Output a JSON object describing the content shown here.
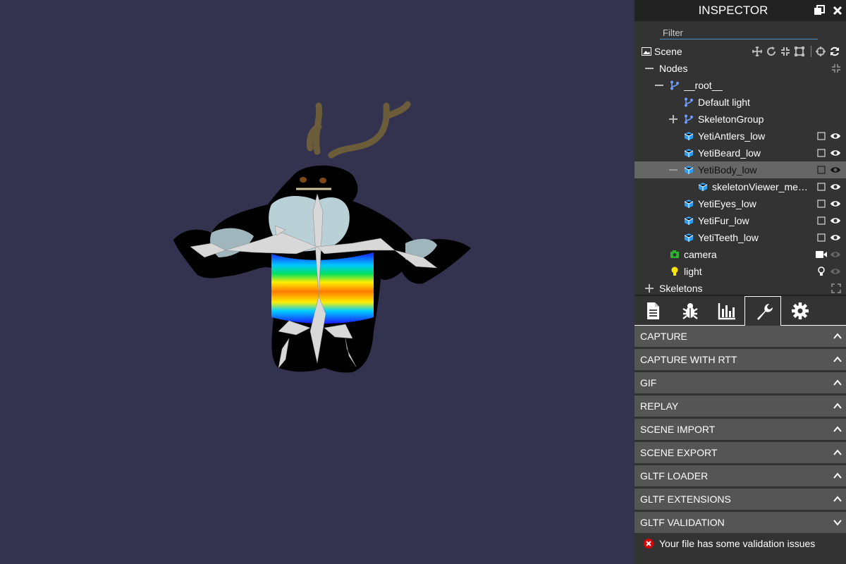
{
  "inspector": {
    "title": "INSPECTOR",
    "filter_placeholder": "Filter"
  },
  "tree": {
    "scene_label": "Scene",
    "nodes_label": "Nodes",
    "root_label": "__root__",
    "default_light": "Default light",
    "skeleton_group": "SkeletonGroup",
    "meshes": [
      "YetiAntlers_low",
      "YetiBeard_low",
      "YetiBody_low",
      "skeletonViewer_me…",
      "YetiEyes_low",
      "YetiFur_low",
      "YetiTeeth_low"
    ],
    "camera_label": "camera",
    "light_label": "light",
    "skeletons_label": "Skeletons"
  },
  "tabs": [
    "properties-tab",
    "debug-tab",
    "statistics-tab",
    "tools-tab",
    "settings-tab"
  ],
  "active_tab": "tools-tab",
  "panes": [
    "CAPTURE",
    "CAPTURE WITH RTT",
    "GIF",
    "REPLAY",
    "SCENE IMPORT",
    "SCENE EXPORT",
    "GLTF LOADER",
    "GLTF EXTENSIONS",
    "GLTF VALIDATION"
  ],
  "validation_message": "Your file has some validation issues",
  "colors": {
    "viewport_bg": "#333350",
    "panel_bg": "#333333",
    "header_bg": "#222222",
    "pane_bg": "#555555",
    "selected_row": "#666666",
    "mesh_icon": "#2a9df4",
    "node_icon": "#6f9cff",
    "camera_icon": "#2db52d",
    "light_icon": "#ffe600",
    "error": "#e00000"
  }
}
